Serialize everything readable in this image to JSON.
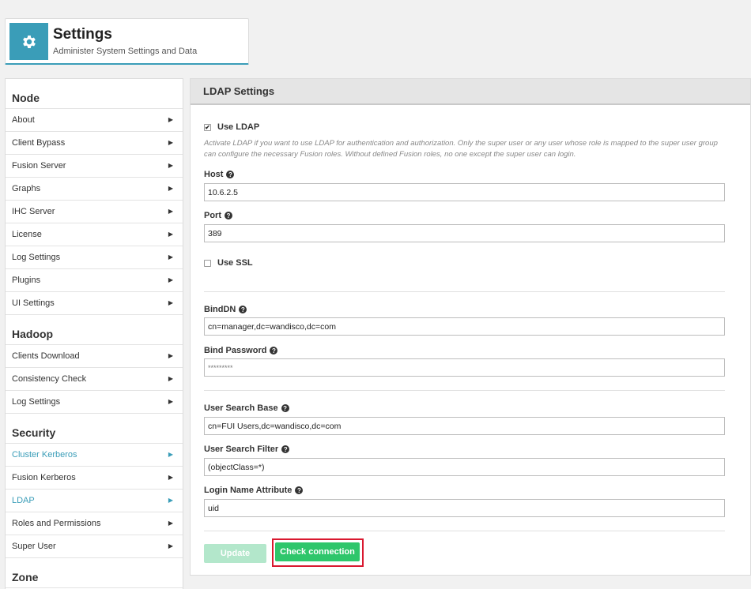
{
  "header": {
    "title": "Settings",
    "subtitle": "Administer System Settings and Data",
    "icon": "gear-icon",
    "accent_color": "#3a9db8"
  },
  "sidebar": {
    "sections": [
      {
        "title": "Node",
        "items": [
          {
            "label": "About",
            "active": false
          },
          {
            "label": "Client Bypass",
            "active": false
          },
          {
            "label": "Fusion Server",
            "active": false
          },
          {
            "label": "Graphs",
            "active": false
          },
          {
            "label": "IHC Server",
            "active": false
          },
          {
            "label": "License",
            "active": false
          },
          {
            "label": "Log Settings",
            "active": false
          },
          {
            "label": "Plugins",
            "active": false
          },
          {
            "label": "UI Settings",
            "active": false
          }
        ]
      },
      {
        "title": "Hadoop",
        "items": [
          {
            "label": "Clients Download",
            "active": false
          },
          {
            "label": "Consistency Check",
            "active": false
          },
          {
            "label": "Log Settings",
            "active": false
          }
        ]
      },
      {
        "title": "Security",
        "items": [
          {
            "label": "Cluster Kerberos",
            "active": true
          },
          {
            "label": "Fusion Kerberos",
            "active": false
          },
          {
            "label": "LDAP",
            "active": true
          },
          {
            "label": "Roles and Permissions",
            "active": false
          },
          {
            "label": "Super User",
            "active": false
          }
        ]
      },
      {
        "title": "Zone",
        "items": []
      }
    ],
    "arrow_icon": "chevron-right-icon"
  },
  "panel": {
    "title": "LDAP Settings",
    "use_ldap": {
      "label": "Use LDAP",
      "checked": true
    },
    "help_text": "Activate LDAP if you want to use LDAP for authentication and authorization. Only the super user or any user whose role is mapped to the super user group can configure the necessary Fusion roles. Without defined Fusion roles, no one except the super user can login.",
    "host": {
      "label": "Host",
      "value": "10.6.2.5"
    },
    "port": {
      "label": "Port",
      "value": "389"
    },
    "use_ssl": {
      "label": "Use SSL",
      "checked": false
    },
    "bind_dn": {
      "label": "BindDN",
      "value": "cn=manager,dc=wandisco,dc=com"
    },
    "bind_password": {
      "label": "Bind Password",
      "value": "*********"
    },
    "user_search_base": {
      "label": "User Search Base",
      "value": "cn=FUI Users,dc=wandisco,dc=com"
    },
    "user_search_filter": {
      "label": "User Search Filter",
      "value": "(objectClass=*)"
    },
    "login_name_attribute": {
      "label": "Login Name Attribute",
      "value": "uid"
    },
    "help_icon": "question-circle-icon",
    "buttons": {
      "update": "Update",
      "check_connection": "Check connection"
    },
    "colors": {
      "update_disabled": "#b3e7cb",
      "check_connection": "#2ec66b",
      "highlight_border": "#d9182f"
    }
  }
}
